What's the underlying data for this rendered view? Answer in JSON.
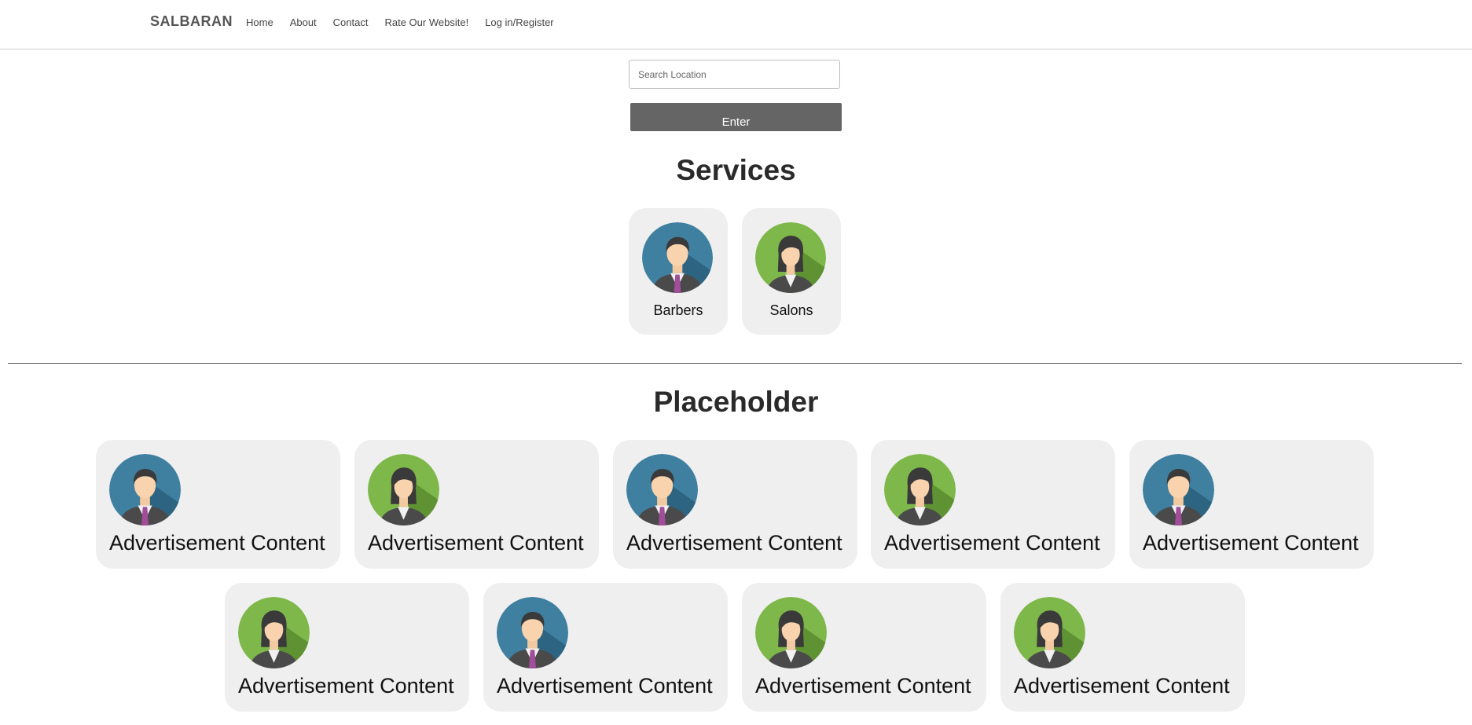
{
  "header": {
    "brand": "SALBARAN",
    "nav": [
      {
        "label": "Home"
      },
      {
        "label": "About"
      },
      {
        "label": "Contact"
      },
      {
        "label": "Rate Our Website!"
      },
      {
        "label": "Log in/Register"
      }
    ]
  },
  "search": {
    "placeholder": "Search Location",
    "value": "",
    "button_label": "Enter"
  },
  "services": {
    "title": "Services",
    "items": [
      {
        "label": "Barbers",
        "icon": "man-avatar-icon"
      },
      {
        "label": "Salons",
        "icon": "woman-avatar-icon"
      }
    ]
  },
  "ads": {
    "title": "Placeholder",
    "items": [
      {
        "label": "Advertisement Content",
        "icon": "man-avatar-icon"
      },
      {
        "label": "Advertisement Content",
        "icon": "woman-avatar-icon"
      },
      {
        "label": "Advertisement Content",
        "icon": "man-avatar-icon"
      },
      {
        "label": "Advertisement Content",
        "icon": "woman-avatar-icon"
      },
      {
        "label": "Advertisement Content",
        "icon": "man-avatar-icon"
      },
      {
        "label": "Advertisement Content",
        "icon": "woman-avatar-icon"
      },
      {
        "label": "Advertisement Content",
        "icon": "man-avatar-icon"
      },
      {
        "label": "Advertisement Content",
        "icon": "woman-avatar-icon"
      },
      {
        "label": "Advertisement Content",
        "icon": "woman-avatar-icon"
      }
    ]
  },
  "colors": {
    "man_avatar_bg": "#3f7fa0",
    "woman_avatar_bg": "#7fb84a",
    "card_bg": "#efefef",
    "button_bg": "#656565"
  }
}
